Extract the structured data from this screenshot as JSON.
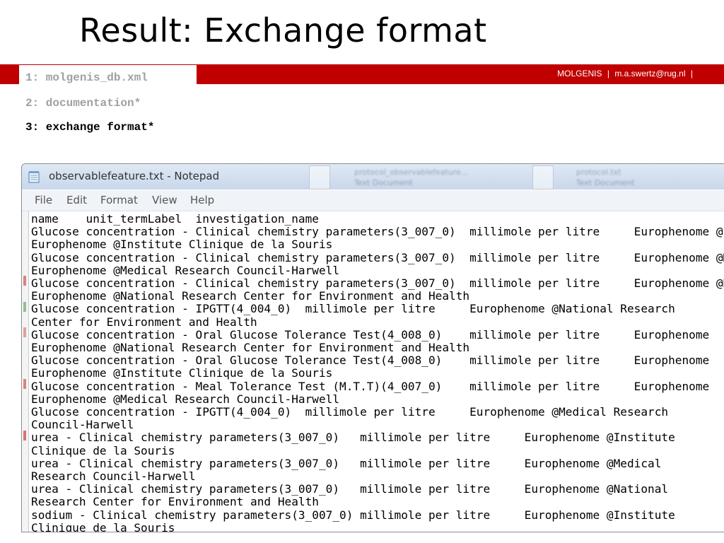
{
  "slide": {
    "title": "Result: Exchange format",
    "header_org": "MOLGENIS",
    "header_sep1": "|",
    "header_email": "m.a.swertz@rug.nl",
    "header_sep2": "|",
    "items": [
      {
        "label": "1: molgenis_db.xml"
      },
      {
        "label": "2: documentation*"
      },
      {
        "label": "3: exchange format*"
      }
    ]
  },
  "notepad": {
    "title": "observablefeature.txt - Notepad",
    "icon": "notepad-icon",
    "menu": [
      "File",
      "Edit",
      "Format",
      "View",
      "Help"
    ],
    "background_window": {
      "tab1_line1": "protocol_observablefeature...",
      "tab1_line2": "Text Document",
      "tab2_line1": "protocol.txt",
      "tab2_line2": "Text Document"
    },
    "lines": [
      "name    unit_termLabel  investigation_name",
      "Glucose concentration - Clinical chemistry parameters(3_007_0)  millimole per litre     Europhenome @Institute",
      "Europhenome @Institute Clinique de la Souris",
      "Glucose concentration - Clinical chemistry parameters(3_007_0)  millimole per litre     Europhenome @Medical",
      "Europhenome @Medical Research Council-Harwell",
      "Glucose concentration - Clinical chemistry parameters(3_007_0)  millimole per litre     Europhenome @National",
      "Europhenome @National Research Center for Environment and Health",
      "Glucose concentration - IPGTT(4_004_0)  millimole per litre     Europhenome @National Research",
      "Center for Environment and Health",
      "Glucose concentration - Oral Glucose Tolerance Test(4_008_0)    millimole per litre     Europhenome",
      "Europhenome @National Research Center for Environment and Health",
      "Glucose concentration - Oral Glucose Tolerance Test(4_008_0)    millimole per litre     Europhenome",
      "Europhenome @Institute Clinique de la Souris",
      "Glucose concentration - Meal Tolerance Test (M.T.T)(4_007_0)    millimole per litre     Europhenome",
      "Europhenome @Medical Research Council-Harwell",
      "Glucose concentration - IPGTT(4_004_0)  millimole per litre     Europhenome @Medical Research",
      "Council-Harwell",
      "urea - Clinical chemistry parameters(3_007_0)   millimole per litre     Europhenome @Institute",
      "Clinique de la Souris",
      "urea - Clinical chemistry parameters(3_007_0)   millimole per litre     Europhenome @Medical",
      "Research Council-Harwell",
      "urea - Clinical chemistry parameters(3_007_0)   millimole per litre     Europhenome @National",
      "Research Center for Environment and Health",
      "sodium - Clinical chemistry parameters(3_007_0) millimole per litre     Europhenome @Institute",
      "Clinique de la Souris"
    ]
  },
  "colors": {
    "accent_red": "#c00000",
    "inactive_item": "#a0a0a0"
  }
}
